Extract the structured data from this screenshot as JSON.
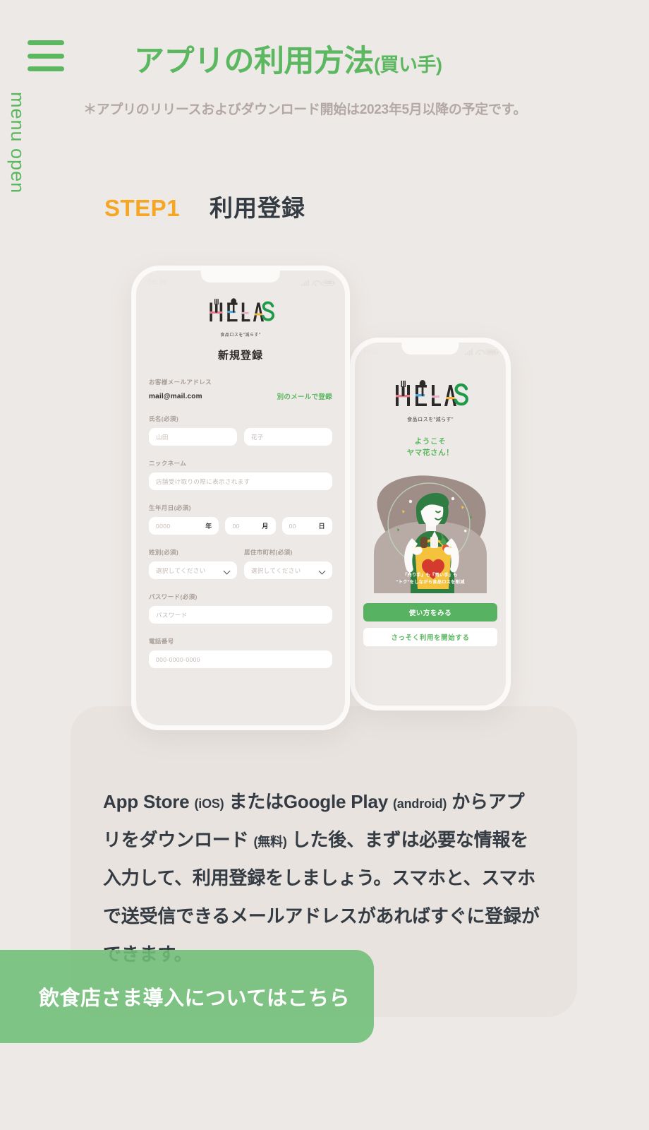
{
  "header": {
    "menu_icon": "hamburger-icon",
    "menu_label": "menu open",
    "title_main": "アプリの利用方法",
    "title_sub": "(買い手)",
    "note": "＊アプリのリリースおよびダウンロード開始は2023年5月以降の予定です。",
    "title_color": "#5CB860",
    "note_color": "#B3A8A3"
  },
  "step": {
    "number": "STEP1",
    "name": "利用登録",
    "number_color": "#F5A623",
    "name_color": "#343B43"
  },
  "phone1": {
    "status_time": "09:30",
    "logo_word": "HELAS",
    "logo_tagline": "食品ロスを\"減らす\"",
    "screen_title": "新規登録",
    "email_label": "お客様メールアドレス",
    "email_value": "mail@mail.com",
    "email_link": "別のメールで登録",
    "name_label": "氏名(必須)",
    "name_first_placeholder": "山田",
    "name_last_placeholder": "花子",
    "nickname_label": "ニックネーム",
    "nickname_placeholder": "店舗受け取りの際に表示されます",
    "birth_label": "生年月日(必須)",
    "birth_year_placeholder": "0000",
    "birth_year_suffix": "年",
    "birth_month_placeholder": "00",
    "birth_month_suffix": "月",
    "birth_day_placeholder": "00",
    "birth_day_suffix": "日",
    "gender_label": "姓別(必須)",
    "gender_placeholder": "選択してください",
    "city_label": "居住市町村(必須)",
    "city_placeholder": "選択してください",
    "password_label": "パスワード(必須)",
    "password_placeholder": "パスワード",
    "tel_label": "電話番号",
    "tel_placeholder": "000-0000-0000"
  },
  "phone2": {
    "status_time": "09:30",
    "logo_word": "HELAS",
    "logo_tagline": "食品ロスを\"減らす\"",
    "welcome_line1": "ようこそ",
    "welcome_line2": "ヤマ花さん！",
    "illus_caption_line1": "『売り手』も『買い手』も",
    "illus_caption_line2": "\"トク\"をしながら食品ロスを削減",
    "btn_primary": "使い方をみる",
    "btn_secondary": "さっそく利用を開始する",
    "btn_primary_color": "#57B261"
  },
  "body": {
    "line1": "App Store",
    "line1_small": "(iOS)",
    "line1_b": "またはGoogle Play",
    "line1_small2": "(android)",
    "line1_c": "か",
    "line2": "らアプリをダウンロード",
    "line2_small": "(無料)",
    "line2_b": "した後、まずは必",
    "line3": "要な情報を入力して、利用登録をしましょう。",
    "line4": "スマホと、スマホで送受信できるメールアドレス",
    "line5": "があればすぐに登録ができます。"
  },
  "cta": {
    "label": "飲食店さま導入についてはこちら",
    "color": "#6EBE76"
  }
}
